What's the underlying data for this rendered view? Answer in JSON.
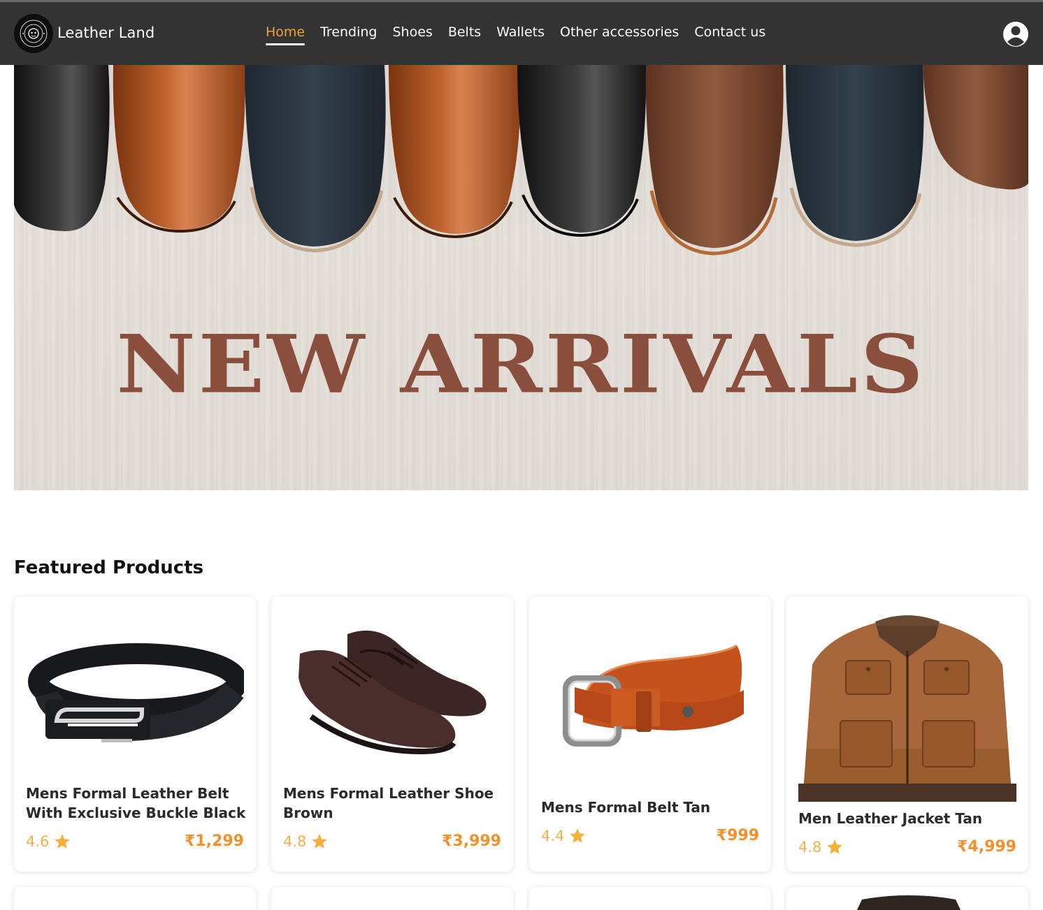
{
  "brand": {
    "name": "Leather Land"
  },
  "nav": {
    "items": [
      {
        "label": "Home",
        "active": true
      },
      {
        "label": "Trending",
        "active": false
      },
      {
        "label": "Shoes",
        "active": false
      },
      {
        "label": "Belts",
        "active": false
      },
      {
        "label": "Wallets",
        "active": false
      },
      {
        "label": "Other accessories",
        "active": false
      },
      {
        "label": "Contact us",
        "active": false
      }
    ],
    "account_icon": "user-circle-icon"
  },
  "hero": {
    "title": "NEW ARRIVALS"
  },
  "featured": {
    "title": "Featured Products",
    "products": [
      {
        "name": "Mens Formal Leather Belt With Exclusive Buckle Black",
        "rating": "4.6",
        "price": "₹1,299",
        "image": "black-belt-image"
      },
      {
        "name": "Mens Formal Leather Shoe Brown",
        "rating": "4.8",
        "price": "₹3,999",
        "image": "brown-shoes-image"
      },
      {
        "name": "Mens Formal Belt Tan",
        "rating": "4.4",
        "price": "₹999",
        "image": "tan-belt-image"
      },
      {
        "name": "Men Leather Jacket Tan",
        "rating": "4.8",
        "price": "₹4,999",
        "image": "tan-jacket-image"
      }
    ]
  },
  "colors": {
    "navbar": "#333333",
    "accent": "#f0a038",
    "price": "#f0912e",
    "rating": "#f0b24a",
    "hero_title": "#8a4f3c"
  }
}
